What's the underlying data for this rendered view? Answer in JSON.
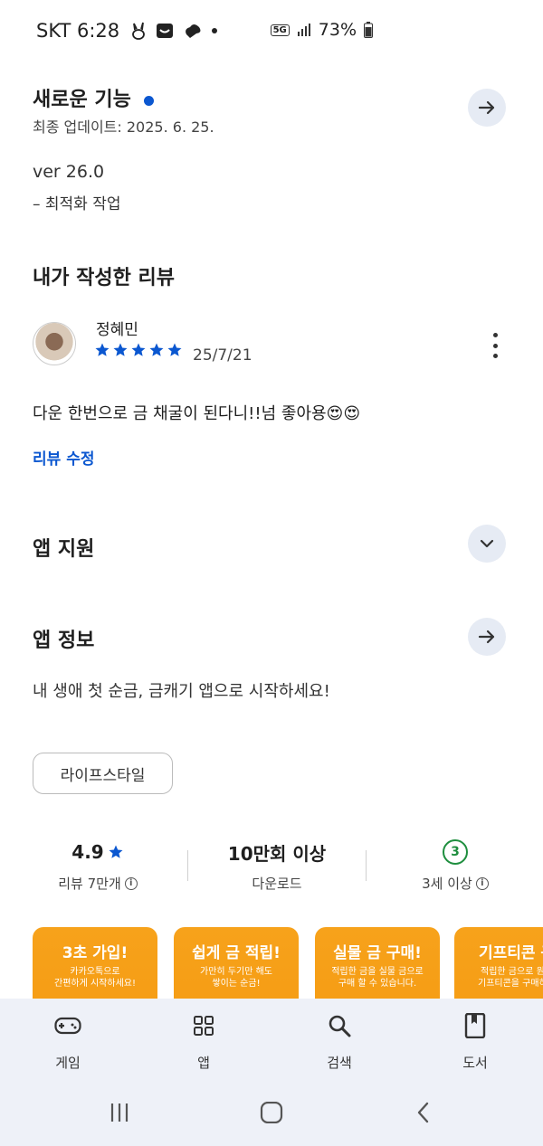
{
  "status_bar": {
    "carrier_time": "SKT 6:28",
    "network": "5G",
    "battery": "73%"
  },
  "whats_new": {
    "title": "새로운 기능",
    "updated": "최종 업데이트: 2025. 6. 25.",
    "version": "ver 26.0",
    "note": "– 최적화 작업"
  },
  "my_review": {
    "title": "내가 작성한 리뷰",
    "reviewer": "정혜민",
    "rating": 5,
    "date": "25/7/21",
    "text": "다운 한번으로 금 채굴이 된다니!!넘 좋아용😍😍",
    "edit_label": "리뷰 수정"
  },
  "app_support": {
    "title": "앱 지원"
  },
  "app_info": {
    "title": "앱 정보",
    "description": "내 생애 첫 순금, 금캐기 앱으로 시작하세요!",
    "category_chip": "라이프스타일"
  },
  "stats": {
    "rating_value": "4.9",
    "reviews_label": "리뷰 7만개",
    "downloads_value": "10만회 이상",
    "downloads_label": "다운로드",
    "age_badge": "3",
    "age_label": "3세 이상"
  },
  "screenshots": [
    {
      "headline": "3초 가입!",
      "sub1": "카카오톡으로",
      "sub2": "간편하게 시작하세요!"
    },
    {
      "headline": "쉽게 금 적립!",
      "sub1": "가만히 두기만 해도",
      "sub2": "쌓이는 순금!"
    },
    {
      "headline": "실물 금 구매!",
      "sub1": "적립한 금을 실물 금으로",
      "sub2": "구매 할 수 있습니다."
    },
    {
      "headline": "기프티콘 구",
      "sub1": "적립한 금으로 원하",
      "sub2": "기프티콘을 구매하세"
    }
  ],
  "bottom_nav": [
    {
      "label": "게임",
      "icon": "gamepad-icon"
    },
    {
      "label": "앱",
      "icon": "apps-grid-icon"
    },
    {
      "label": "검색",
      "icon": "search-icon"
    },
    {
      "label": "도서",
      "icon": "book-icon"
    }
  ],
  "colors": {
    "accent": "#0b57d0",
    "chip_bg": "#e6ebf4",
    "nav_bg": "#eef1f8",
    "age_green": "#1e8e3e",
    "shot_orange": "#f7a21b"
  }
}
